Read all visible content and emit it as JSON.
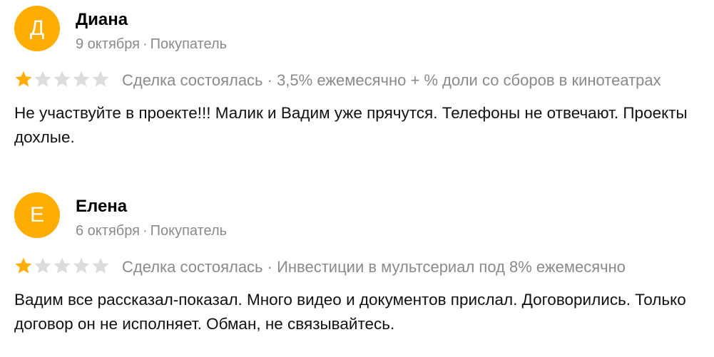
{
  "colors": {
    "avatar": "#ffad00",
    "star_filled": "#ffad00",
    "star_empty": "#dcdcdc",
    "meta_text": "#8a8a8a"
  },
  "reviews": [
    {
      "avatar_letter": "Д",
      "author": "Диана",
      "date": "9 октября",
      "meta_separator": "·",
      "role": "Покупатель",
      "rating": 1,
      "rating_max": 5,
      "deal_text": "Сделка состоялась · 3,5% ежемесячно + % доли со сборов в кинотеатрах",
      "text": "Не участвуйте в проекте!!! Малик и Вадим уже прячутся. Телефоны не отвечают. Проекты дохлые."
    },
    {
      "avatar_letter": "Е",
      "author": "Елена",
      "date": "6 октября",
      "meta_separator": "·",
      "role": "Покупатель",
      "rating": 1,
      "rating_max": 5,
      "deal_text": "Сделка состоялась · Инвестиции в мультсериал под 8% ежемесячно",
      "text": "Вадим все рассказал-показал. Много видео и документов прислал. Договорились. Только договор он не исполняет. Обман, не связывайтесь."
    }
  ]
}
